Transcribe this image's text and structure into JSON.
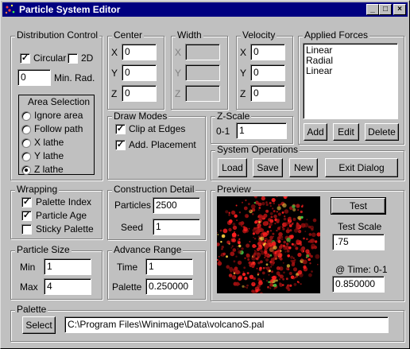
{
  "window": {
    "title": "Particle System Editor",
    "min": "_",
    "max": "□",
    "close": "×"
  },
  "distribution": {
    "title": "Distribution Control",
    "circular_label": "Circular",
    "circular_checked": true,
    "twod_label": "2D",
    "twod_checked": false,
    "min_rad_value": "0",
    "min_rad_label": "Min. Rad.",
    "area_title": "Area Selection",
    "area_options": [
      "Ignore area",
      "Follow path",
      "X lathe",
      "Y lathe",
      "Z lathe"
    ],
    "area_selected": 4
  },
  "center": {
    "title": "Center",
    "x_label": "X",
    "y_label": "Y",
    "z_label": "Z",
    "x": "0",
    "y": "0",
    "z": "0"
  },
  "width": {
    "title": "Width",
    "x_label": "X",
    "y_label": "Y",
    "z_label": "Z",
    "x": "",
    "y": "",
    "z": ""
  },
  "velocity": {
    "title": "Velocity",
    "x_label": "X",
    "y_label": "Y",
    "z_label": "Z",
    "x": "0",
    "y": "0",
    "z": "0"
  },
  "forces": {
    "title": "Applied Forces",
    "items": [
      "Linear",
      "Radial",
      "Linear"
    ],
    "add_label": "Add",
    "edit_label": "Edit",
    "delete_label": "Delete"
  },
  "draw_modes": {
    "title": "Draw Modes",
    "clip_label": "Clip at Edges",
    "clip_checked": true,
    "add_label": "Add. Placement",
    "add_checked": true
  },
  "zscale": {
    "title": "Z-Scale",
    "range_label": "0-1",
    "value": "1"
  },
  "system_ops": {
    "title": "System Operations",
    "load": "Load",
    "save": "Save",
    "new": "New",
    "exit": "Exit Dialog"
  },
  "wrapping": {
    "title": "Wrapping",
    "palette_index": "Palette Index",
    "palette_index_checked": true,
    "particle_age": "Particle Age",
    "particle_age_checked": true,
    "sticky": "Sticky Palette",
    "sticky_checked": false
  },
  "construction": {
    "title": "Construction Detail",
    "particles_label": "Particles",
    "particles": "2500",
    "seed_label": "Seed",
    "seed": "1"
  },
  "preview": {
    "title": "Preview",
    "test_label": "Test",
    "test_scale_label": "Test Scale",
    "test_scale": ".75",
    "time_label": "@ Time: 0-1",
    "time": "0.850000"
  },
  "particle_size": {
    "title": "Particle Size",
    "min_label": "Min",
    "min": "1",
    "max_label": "Max",
    "max": "4"
  },
  "advance": {
    "title": "Advance Range",
    "time_label": "Time",
    "time": "1",
    "palette_label": "Palette",
    "palette": "0.250000"
  },
  "palette": {
    "title": "Palette",
    "select_label": "Select",
    "path": "C:\\Program Files\\Winimage\\Data\\volcanoS.pal"
  },
  "colors": {
    "titlebar": "#000080",
    "face": "#c0c0c0",
    "particle": "#e01010"
  }
}
